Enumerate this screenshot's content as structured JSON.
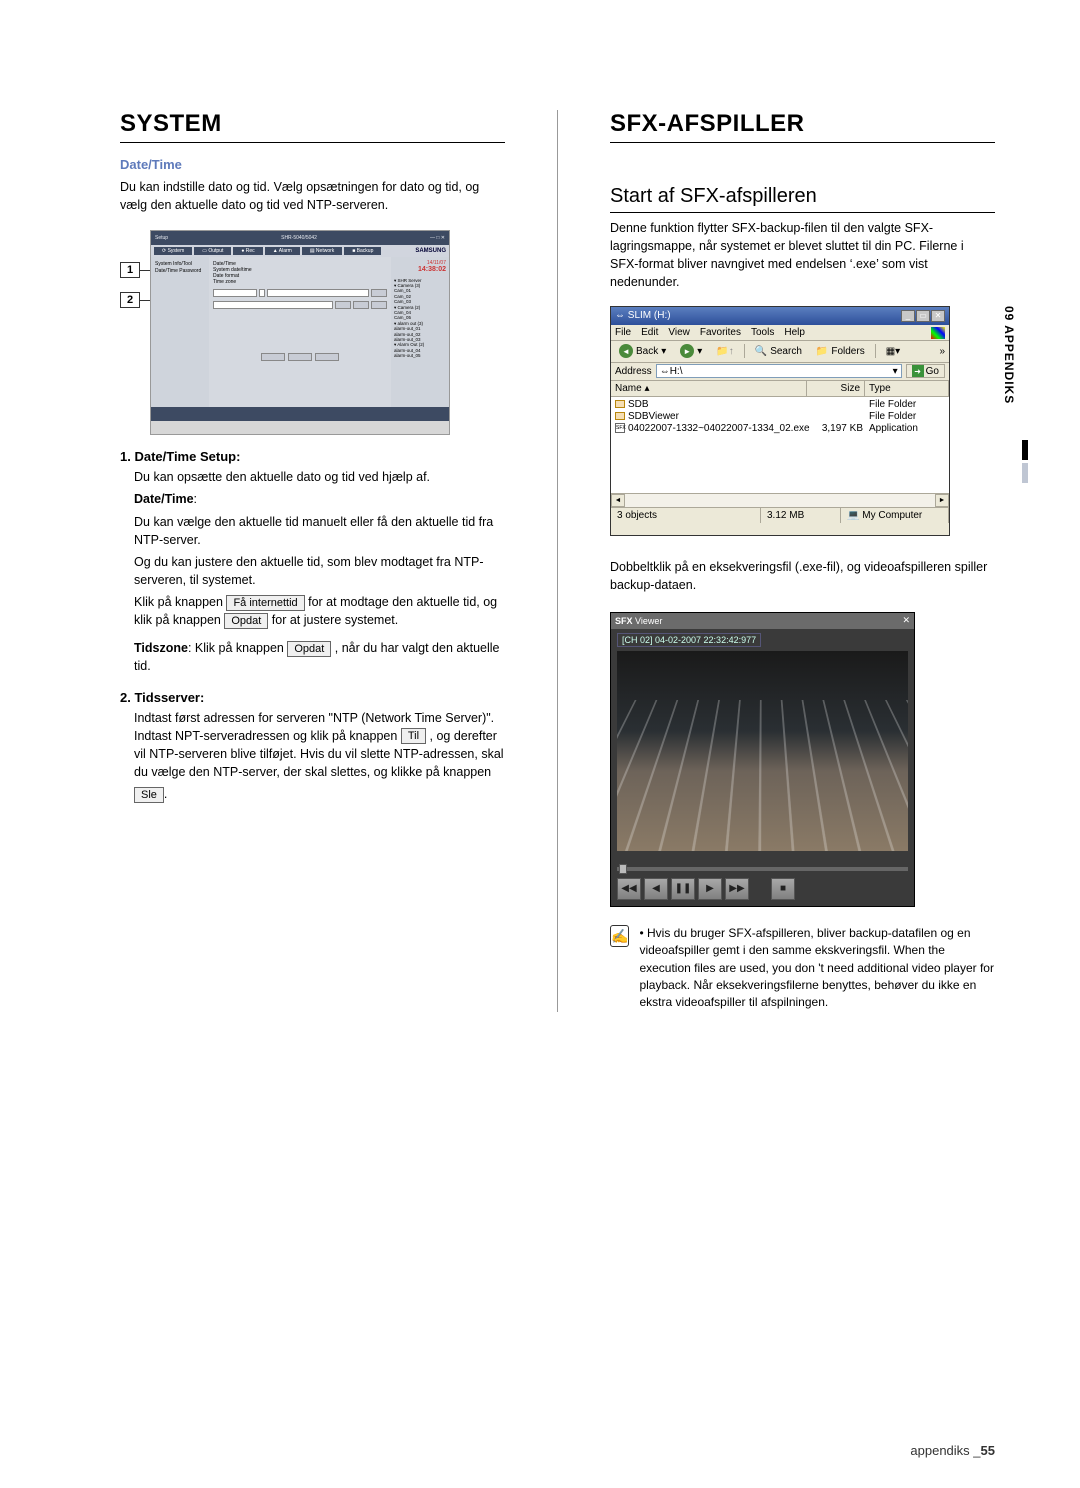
{
  "left": {
    "title": "SYSTEM",
    "date_time_head": "Date/Time",
    "date_time_intro": "Du kan indstille dato og tid. Vælg opsætningen for dato og tid, og vælg den aktuelle dato og tid ved NTP-serveren.",
    "callout": {
      "n1": "1",
      "n2": "2",
      "top_title": "SHR-5040/5042",
      "brand": "SAMSUNG",
      "left_items": "System Info/Tool\nDate/Time\nPassword",
      "time": "14:38:02",
      "tree": "▾ SHR Server\n  ▾ Camera (3)\n     Cam_01\n     Cam_02\n     Cam_03\n  ▾ Camera (2)\n     Cam_04\n     Cam_05\n  ▾ alarm out (3)\n     alarm-out_01\n     alarm-out_02\n     alarm-out_03\n  ▾ Alarm Out (2)\n     alarm-out_04\n     alarm-out_05"
    },
    "step1_head": "1. Date/Time Setup:",
    "step1_p1": "Du kan opsætte den aktuelle dato og tid ved hjælp af.",
    "step1_bold": "Date/Time",
    "step1_p2": "Du kan vælge den aktuelle tid manuelt eller få den aktuelle tid fra NTP-server.",
    "step1_p3": "Og du kan justere den aktuelle tid, som blev modtaget fra NTP-serveren, til systemet.",
    "step1_p4a": "Klik på knappen ",
    "btn_internet": "Få internettid",
    "step1_p4b": " for at modtage den aktuelle tid, og klik på knappen ",
    "btn_opdat": "Opdat",
    "step1_p4c": " for at justere systemet.",
    "step1_tz_a": "Tidszone",
    "step1_tz_b": ": Klik på knappen ",
    "step1_tz_c": ", når du har valgt den aktuelle tid.",
    "step2_head": "2. Tidsserver:",
    "step2_p_a": "Indtast først adressen for serveren \"NTP (Network Time Server)\". Indtast NPT-serveradressen og klik på knappen ",
    "btn_til": "Til",
    "step2_p_b": ", og derefter vil NTP-serveren blive tilføjet. Hvis du vil slette NTP-adressen, skal du vælge den NTP-server, der skal slettes, og klikke på knappen ",
    "btn_sle": "Sle",
    "step2_p_c": "."
  },
  "right": {
    "title": "SFX-AFSPILLER",
    "h2": "Start af SFX-afspilleren",
    "intro": "Denne funktion flytter SFX-backup-filen til den valgte SFX-lagringsmappe, når systemet er blevet sluttet til din PC. Filerne i SFX-format bliver navngivet med endelsen ‘.exe’ som vist nedenunder.",
    "explorer": {
      "title_icon": "⇔",
      "title": "SLIM (H:)",
      "min": "_",
      "max": "▭",
      "close": "✕",
      "menu": {
        "file": "File",
        "edit": "Edit",
        "view": "View",
        "favorites": "Favorites",
        "tools": "Tools",
        "help": "Help"
      },
      "tool": {
        "back": "Back",
        "search": "Search",
        "folders": "Folders",
        "arrow_r": "»"
      },
      "addr_label": "Address",
      "addr_value": "H:\\",
      "go": "Go",
      "cols": {
        "name": "Name",
        "size": "Size",
        "type": "Type"
      },
      "rows": [
        {
          "name": "SDB",
          "size": "",
          "type": "File Folder"
        },
        {
          "name": "SDBViewer",
          "size": "",
          "type": "File Folder"
        },
        {
          "name": "04022007-1332~04022007-1334_02.exe",
          "size": "3,197 KB",
          "type": "Application",
          "sfx": "SFX"
        }
      ],
      "status": {
        "count": "3 objects",
        "size": "3.12 MB",
        "loc": "My Computer"
      }
    },
    "after_explorer": "Dobbeltklik på en eksekveringsfil (.exe-fil), og videoafspilleren spiller backup-dataen.",
    "viewer": {
      "brand": "SFX",
      "title": "Viewer",
      "close": "✕",
      "overlay": "[CH 02]  04-02-2007 22:32:42:977",
      "ctrl": {
        "rew2": "◀◀",
        "rew": "◀",
        "pause": "❚❚",
        "play": "▶",
        "fwd2": "▶▶",
        "stop": "■"
      }
    },
    "note": "Hvis du bruger SFX-afspilleren, bliver backup-datafilen og en videoafspiller gemt i den samme ekskveringsfil. When the execution files are used, you don 't need additional video player for playback. Når eksekveringsfilerne benyttes, behøver du ikke en ekstra videoafspiller til afspilningen."
  },
  "side_tab": "09 APPENDIKS",
  "footer_label": "appendiks _",
  "footer_page": "55",
  "icons": {
    "note": "✍"
  }
}
